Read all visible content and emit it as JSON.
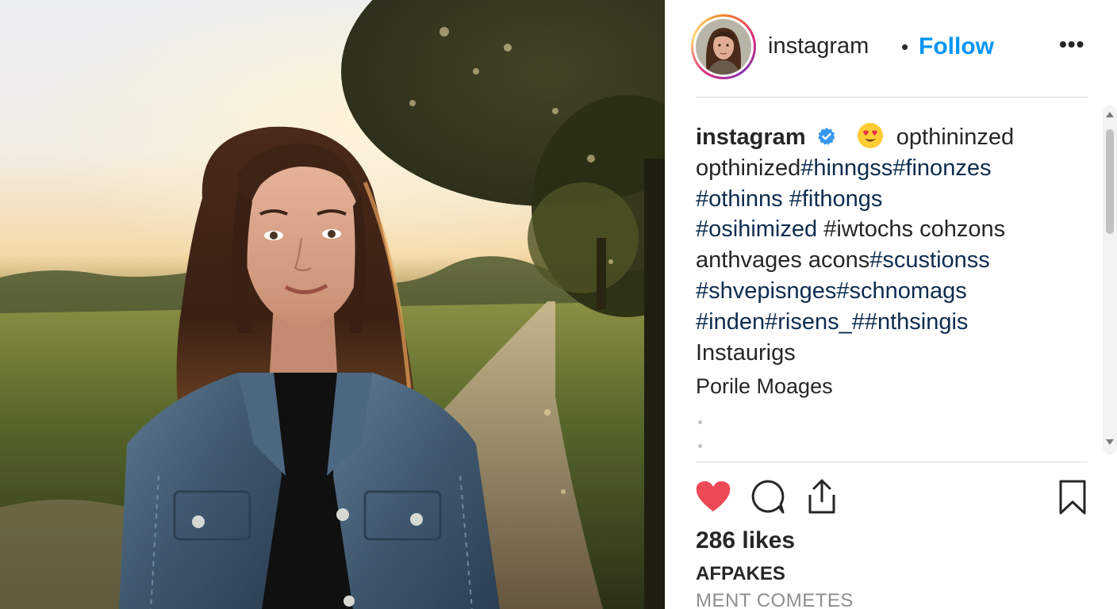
{
  "post": {
    "image_alt": "woman in denim jacket on countryside path at sunset"
  },
  "header": {
    "username": "instagram",
    "separator": "•",
    "follow_label": "Follow",
    "more_label": "•••"
  },
  "caption": {
    "username": "instagram",
    "verified_icon": "verified-badge-icon",
    "emoji_icon": "heart-eyes-emoji",
    "lines": [
      {
        "text": "opthininzed"
      },
      {
        "text1": "opthinized",
        "tags": "#hinngss#finonzes"
      },
      {
        "tags": "#othinns #fithongs"
      },
      {
        "tags": "#osihimized",
        "text": " #iwtochs cohzons"
      },
      {
        "text": "anthvages acons",
        "tags": "#scustionss"
      },
      {
        "tags": "#shvepisnges#schnomags"
      },
      {
        "tags": "#inden#risens_##nthsingis"
      },
      {
        "text": "Instaurigs"
      }
    ],
    "secondary": "Porile Moages"
  },
  "actions": {
    "like_icon": "heart-icon",
    "comment_icon": "comment-icon",
    "share_icon": "share-icon",
    "save_icon": "bookmark-icon"
  },
  "likes_text": "286 likes",
  "extra_label": "AFPAKES",
  "comments_label": "MENT COMETES",
  "colors": {
    "follow_blue": "#0095f6",
    "hashtag": "#0d2c4f",
    "like_red": "#ed4956",
    "verified_blue": "#3897f0"
  }
}
